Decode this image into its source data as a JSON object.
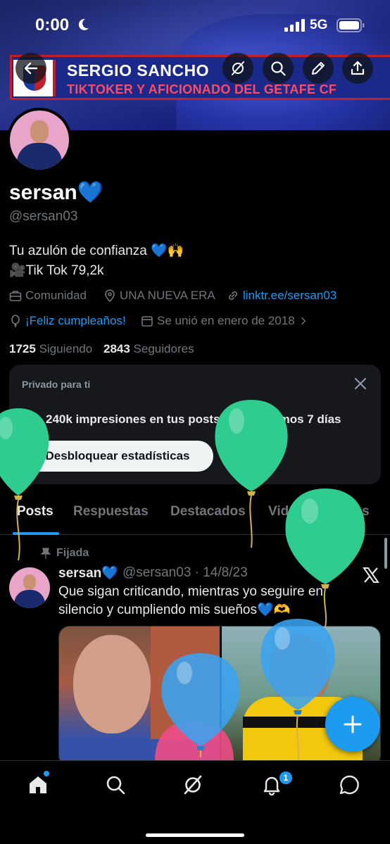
{
  "status_bar": {
    "time": "0:00",
    "network": "5G"
  },
  "banner": {
    "line1": "SERGIO SANCHO",
    "line2": "TIKTOKER Y AFICIONADO DEL GETAFE CF"
  },
  "profile": {
    "display_name": "sersan💙",
    "handle": "@sersan03",
    "bio_line1": "Tu azulón de confianza 💙🙌",
    "bio_line2": "🎥Tik Tok 79,2k",
    "category": "Comunidad",
    "location": "UNA NUEVA ERA",
    "link": "linktr.ee/sersan03",
    "birthday": "¡Feliz cumpleaños!",
    "joined": "Se unió en enero de 2018",
    "following_count": "1725",
    "following_label": "Siguiendo",
    "followers_count": "2843",
    "followers_label": "Seguidores"
  },
  "analytics_card": {
    "title": "Privado para ti",
    "impressions_text": "240k impresiones en tus posts en los últimos 7 días",
    "unlock_button": "Desbloquear estadísticas"
  },
  "tabs": [
    {
      "label": "Posts"
    },
    {
      "label": "Respuestas"
    },
    {
      "label": "Destacados"
    },
    {
      "label": "Videos"
    },
    {
      "label": "Fotos"
    }
  ],
  "pinned_post": {
    "pinned_label": "Fijada",
    "author_name": "sersan💙",
    "meta": "@sersan03 · 14/8/23",
    "text": "Que sigan criticando, mientras yo seguire en silencio y cumpliendo mis sueños💙🫶"
  },
  "bottom_nav": {
    "notifications_badge": "1",
    "items": [
      "home-icon",
      "search-icon",
      "grok-icon",
      "notifications-icon",
      "messages-icon"
    ]
  },
  "colors": {
    "accent": "#1d9bf0",
    "background": "#000000",
    "secondary_text": "#71767b",
    "balloon_green": "#2ecc8f",
    "balloon_blue": "#3aa3f0"
  }
}
